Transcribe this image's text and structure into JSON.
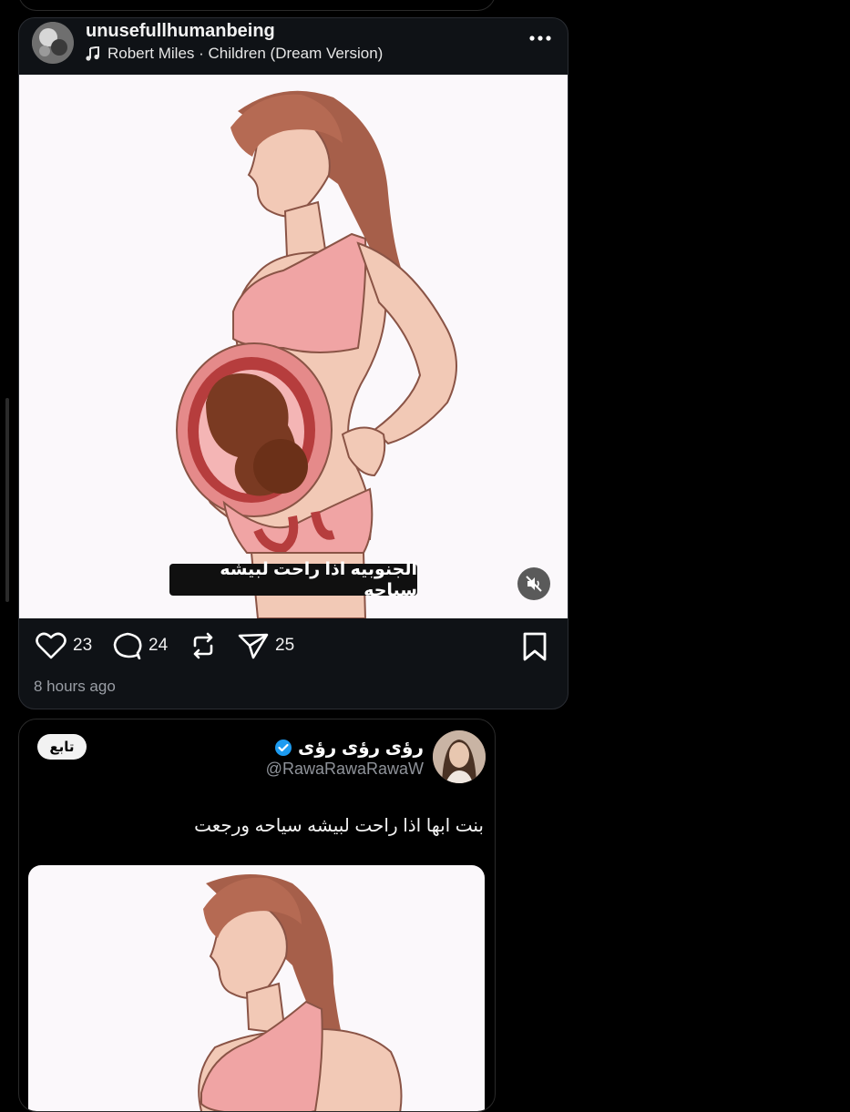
{
  "post": {
    "username": "unusefullhumanbeing",
    "music": "Robert Miles · Children (Dream Version)",
    "caption": "الجنوبيه اذا راحت لبيشه سياحه",
    "likes": "23",
    "comments": "24",
    "shares": "25",
    "time": "8 hours ago"
  },
  "tweet": {
    "display_name": "رؤى رؤى رؤى",
    "handle": "@RawaRawaRawaW",
    "follow_label": "تابع",
    "text": "بنت ابها اذا راحت لبيشه سياحه ورجعت"
  },
  "colors": {
    "background": "#000000",
    "card": "#0f1216",
    "verified": "#1d9bf0",
    "skin": "#f2c9b6",
    "hair": "#a65f4a",
    "bra": "#f0a4a4"
  },
  "icons": [
    "music-note-icon",
    "more-icon",
    "mute-icon",
    "heart-icon",
    "comment-icon",
    "repost-icon",
    "send-icon",
    "bookmark-icon",
    "verified-icon"
  ]
}
